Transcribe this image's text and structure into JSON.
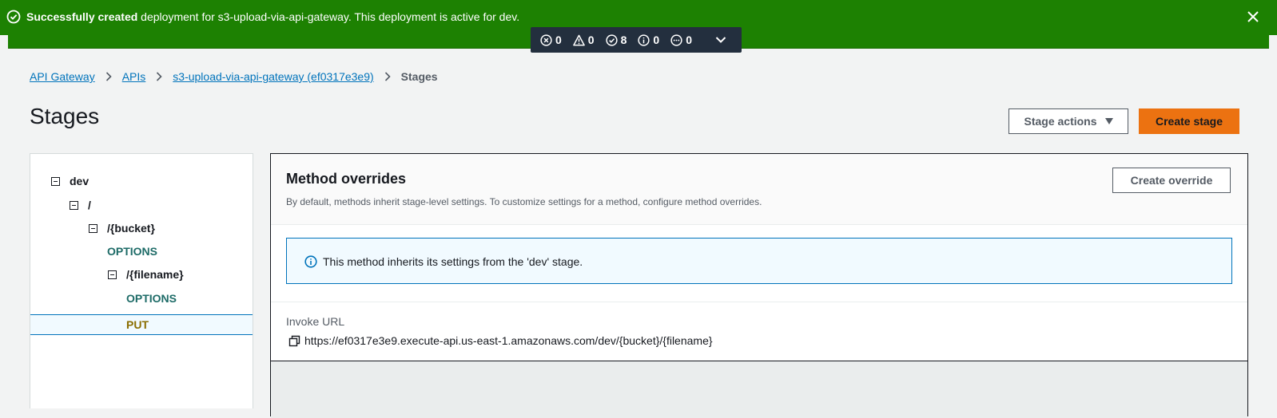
{
  "banner": {
    "bold_text": "Successfully created",
    "message": " deployment for s3-upload-via-api-gateway. This deployment is active for dev.",
    "color": "#1d8102"
  },
  "counts": [
    {
      "icon": "error-icon",
      "value": "0"
    },
    {
      "icon": "warning-icon",
      "value": "0"
    },
    {
      "icon": "success-icon",
      "value": "8"
    },
    {
      "icon": "info-icon",
      "value": "0"
    },
    {
      "icon": "in-progress-icon",
      "value": "0"
    }
  ],
  "breadcrumb": {
    "items": [
      "API Gateway",
      "APIs",
      "s3-upload-via-api-gateway (ef0317e3e9)"
    ],
    "current": "Stages"
  },
  "page": {
    "title": "Stages",
    "stage_actions_label": "Stage actions",
    "create_stage_label": "Create stage"
  },
  "tree": {
    "nodes": [
      "dev",
      "/",
      "/{bucket}",
      "OPTIONS",
      "/{filename}",
      "OPTIONS",
      "PUT"
    ],
    "selected": "PUT"
  },
  "panel": {
    "title": "Method overrides",
    "description": "By default, methods inherit stage-level settings. To customize settings for a method, configure method overrides.",
    "create_override_label": "Create override",
    "info_text": "This method inherits its settings from the 'dev' stage.",
    "invoke_label": "Invoke URL",
    "invoke_url": "https://ef0317e3e9.execute-api.us-east-1.amazonaws.com/dev/{bucket}/{filename}"
  },
  "colors": {
    "accent": "#0073bb",
    "primary_button": "#ec7211",
    "method": "#1d6b67"
  }
}
